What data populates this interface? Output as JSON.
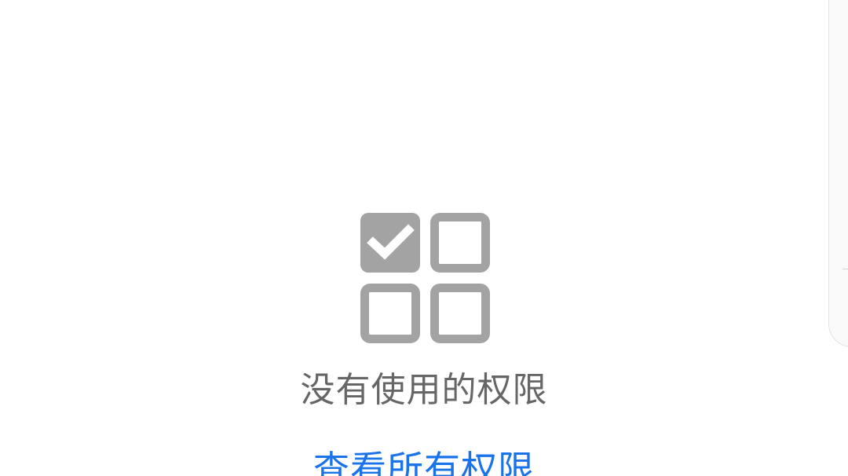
{
  "empty_state": {
    "icon": "permissions-grid-icon",
    "message": "没有使用的权限",
    "link_label": "查看所有权限"
  },
  "colors": {
    "background": "#ffffff",
    "icon_gray": "#a3a3a3",
    "message_text": "#666666",
    "link_blue": "#1a73e8"
  }
}
